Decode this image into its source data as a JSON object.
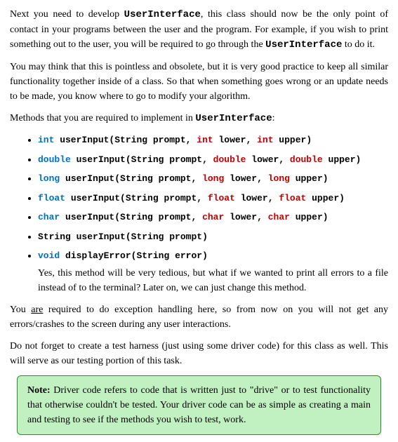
{
  "paragraphs": {
    "intro": {
      "part1": "Next you need to develop ",
      "class1": "UserInterface",
      "part2": ", this class should now be the only point of contact in your programs between the user and the program. For example, if you wish to print something out to the user, you will be required to go through the ",
      "class2": "UserInterface",
      "part3": " to do it."
    },
    "practice": "You may think that this is pointless and obsolete, but it is very good practice to keep all similar functionality together inside of a class. So that when something goes wrong or an update needs to be made, you know where to go to modify your algorithm.",
    "methodsHeader": {
      "part1": "Methods that you are required to implement in ",
      "class": "UserInterface",
      "part2": ":"
    },
    "methods": [
      {
        "ret": "int",
        "retClass": "kw",
        "name": " userInput",
        "paren": "(",
        "p1t": "String",
        "p1c": "",
        "p1n": " prompt",
        "c1": ", ",
        "p2t": "int",
        "p2c": "tparam",
        "p2n": " lower",
        "c2": ", ",
        "p3t": "int",
        "p3c": "tparam",
        "p3n": " upper",
        "end": ")"
      },
      {
        "ret": "double",
        "retClass": "kw",
        "name": " userInput",
        "paren": "(",
        "p1t": "String",
        "p1c": "",
        "p1n": " prompt",
        "c1": ", ",
        "p2t": "double",
        "p2c": "tparam",
        "p2n": " lower",
        "c2": ", ",
        "p3t": "double",
        "p3c": "tparam",
        "p3n": " upper",
        "end": ")"
      },
      {
        "ret": "long",
        "retClass": "kw",
        "name": " userInput",
        "paren": "(",
        "p1t": "String",
        "p1c": "",
        "p1n": " prompt",
        "c1": ", ",
        "p2t": "long",
        "p2c": "tparam",
        "p2n": " lower",
        "c2": ", ",
        "p3t": "long",
        "p3c": "tparam",
        "p3n": " upper",
        "end": ")"
      },
      {
        "ret": "float",
        "retClass": "kw",
        "name": " userInput",
        "paren": "(",
        "p1t": "String",
        "p1c": "",
        "p1n": " prompt",
        "c1": ", ",
        "p2t": "float",
        "p2c": "tparam",
        "p2n": " lower",
        "c2": ", ",
        "p3t": "float",
        "p3c": "tparam",
        "p3n": " upper",
        "end": ")"
      },
      {
        "ret": "char",
        "retClass": "kw",
        "name": " userInput",
        "paren": "(",
        "p1t": "String",
        "p1c": "",
        "p1n": " prompt",
        "c1": ", ",
        "p2t": "char",
        "p2c": "tparam",
        "p2n": " lower",
        "c2": ", ",
        "p3t": "char",
        "p3c": "tparam",
        "p3n": " upper",
        "end": ")"
      },
      {
        "ret": "String",
        "retClass": "",
        "name": " userInput",
        "paren": "(",
        "p1t": "String",
        "p1c": "",
        "p1n": " prompt",
        "c1": "",
        "p2t": "",
        "p2c": "",
        "p2n": "",
        "c2": "",
        "p3t": "",
        "p3c": "",
        "p3n": "",
        "end": ")"
      },
      {
        "ret": "void",
        "retClass": "kw",
        "name": " displayError",
        "paren": "(",
        "p1t": "String",
        "p1c": "",
        "p1n": " error",
        "c1": "",
        "p2t": "",
        "p2c": "",
        "p2n": "",
        "c2": "",
        "p3t": "",
        "p3c": "",
        "p3n": "",
        "end": ")"
      }
    ],
    "afterMethods": "Yes, this method will be very tedious, but what if we wanted to print all errors to a file instead of to the terminal? Later on, we can just change this method.",
    "exception": {
      "part1": "You ",
      "emph": "are",
      "part2": " required to do exception handling here, so from now on you will not get any errors/crashes to the screen during any user interactions."
    },
    "harness": "Do not forget to create a test harness (just using some driver code) for this class as well. This will serve as our testing portion of this task.",
    "note": {
      "label": "Note:",
      "text": " Driver code refers to code that is written just to \"drive\" or to test functionality that otherwise couldn't be tested. Your driver code can be as simple as creating a main and testing to see if the methods you wish to test, work."
    }
  }
}
